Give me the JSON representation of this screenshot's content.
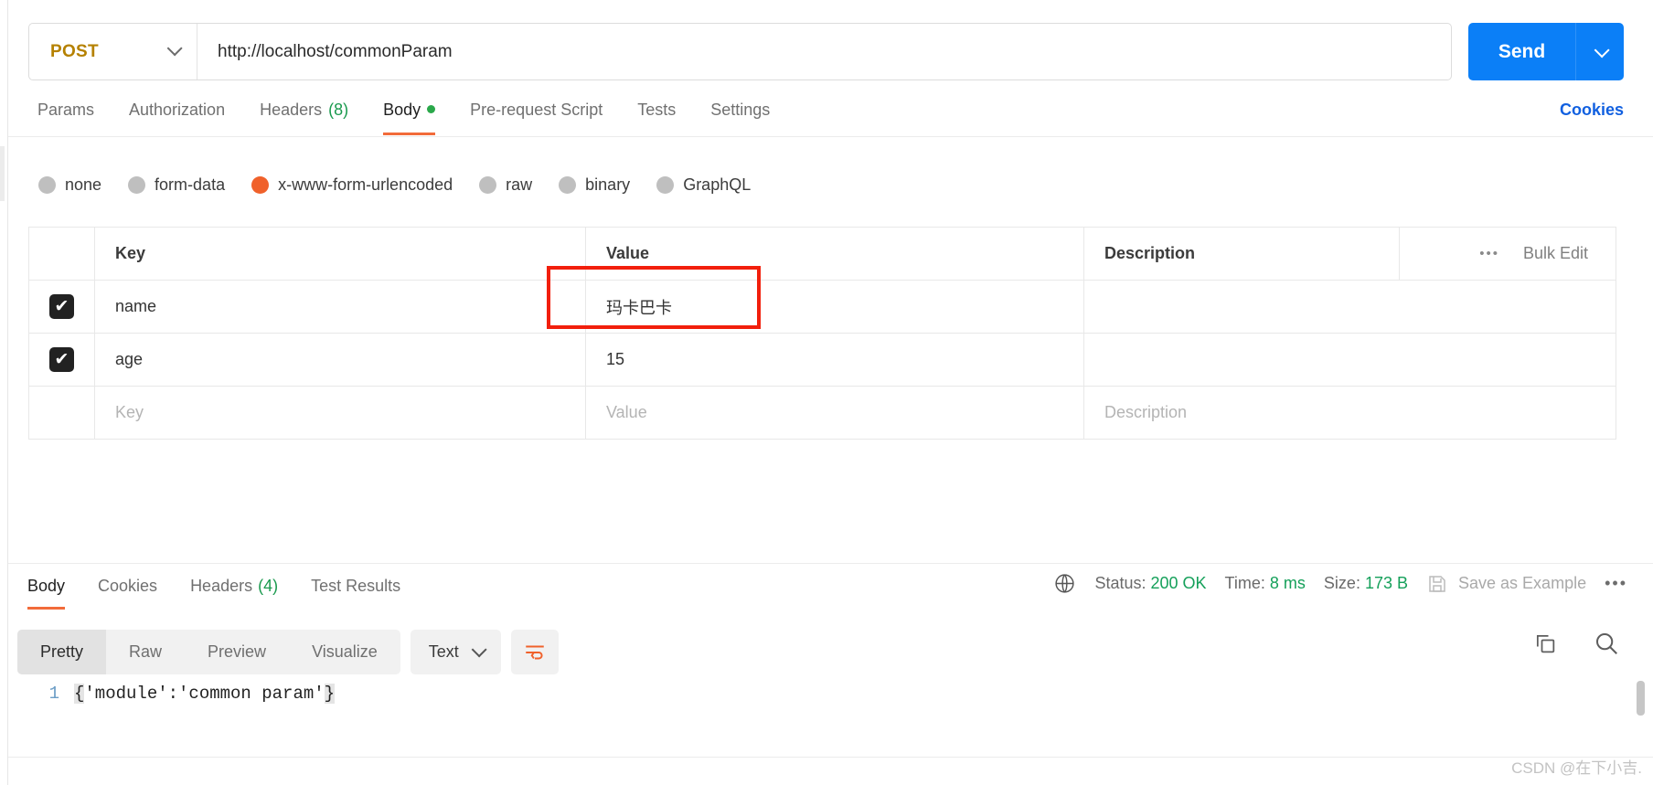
{
  "request": {
    "method": {
      "label": "POST",
      "chevron_icon": "chevron-down-icon"
    },
    "url": "http://localhost/commonParam",
    "send": {
      "label": "Send",
      "caret_icon": "chevron-down-icon",
      "color": "#0b7ff7"
    }
  },
  "request_tabs": [
    {
      "label": "Params",
      "active": false
    },
    {
      "label": "Authorization",
      "active": false
    },
    {
      "label": "Headers",
      "count": "(8)",
      "active": false
    },
    {
      "label": "Body",
      "active": true,
      "dot": true
    },
    {
      "label": "Pre-request Script",
      "active": false
    },
    {
      "label": "Tests",
      "active": false
    },
    {
      "label": "Settings",
      "active": false
    }
  ],
  "cookies_link": "Cookies",
  "body_types": [
    {
      "label": "none",
      "selected": false
    },
    {
      "label": "form-data",
      "selected": false
    },
    {
      "label": "x-www-form-urlencoded",
      "selected": true
    },
    {
      "label": "raw",
      "selected": false
    },
    {
      "label": "binary",
      "selected": false
    },
    {
      "label": "GraphQL",
      "selected": false
    }
  ],
  "params_table": {
    "headers": {
      "key": "Key",
      "value": "Value",
      "description": "Description"
    },
    "bulk": {
      "dots_icon": "ellipsis-icon",
      "label": "Bulk Edit"
    },
    "rows": [
      {
        "checked": true,
        "key": "name",
        "value": "玛卡巴卡",
        "description": ""
      },
      {
        "checked": true,
        "key": "age",
        "value": "15",
        "description": ""
      }
    ],
    "empty_row": {
      "key_placeholder": "Key",
      "value_placeholder": "Value",
      "description_placeholder": "Description"
    },
    "check_glyph": "✔",
    "highlight_color": "#f21f0c"
  },
  "response": {
    "tabs": [
      {
        "label": "Body",
        "active": true
      },
      {
        "label": "Cookies",
        "active": false
      },
      {
        "label": "Headers",
        "count": "(4)",
        "active": false
      },
      {
        "label": "Test Results",
        "active": false
      }
    ],
    "status": {
      "globe_icon": "globe-icon",
      "status_label": "Status:",
      "status_value": "200 OK",
      "time_label": "Time:",
      "time_value": "8 ms",
      "size_label": "Size:",
      "size_value": "173 B",
      "value_color": "#15a05a"
    },
    "save_as_example": {
      "icon": "save-icon",
      "label": "Save as Example"
    },
    "more_icon": "ellipsis-icon",
    "viewer": {
      "modes": [
        {
          "label": "Pretty",
          "active": true
        },
        {
          "label": "Raw",
          "active": false
        },
        {
          "label": "Preview",
          "active": false
        },
        {
          "label": "Visualize",
          "active": false
        }
      ],
      "format": {
        "label": "Text",
        "chevron_icon": "chevron-down-icon"
      },
      "wrap_icon": "wrap-lines-icon",
      "copy_icon": "copy-icon",
      "search_icon": "search-icon"
    },
    "body": {
      "line_number": "1",
      "open_brace": "{",
      "content": "'module':'common param'",
      "close_brace": "}"
    }
  },
  "watermark": "CSDN @在下小吉."
}
